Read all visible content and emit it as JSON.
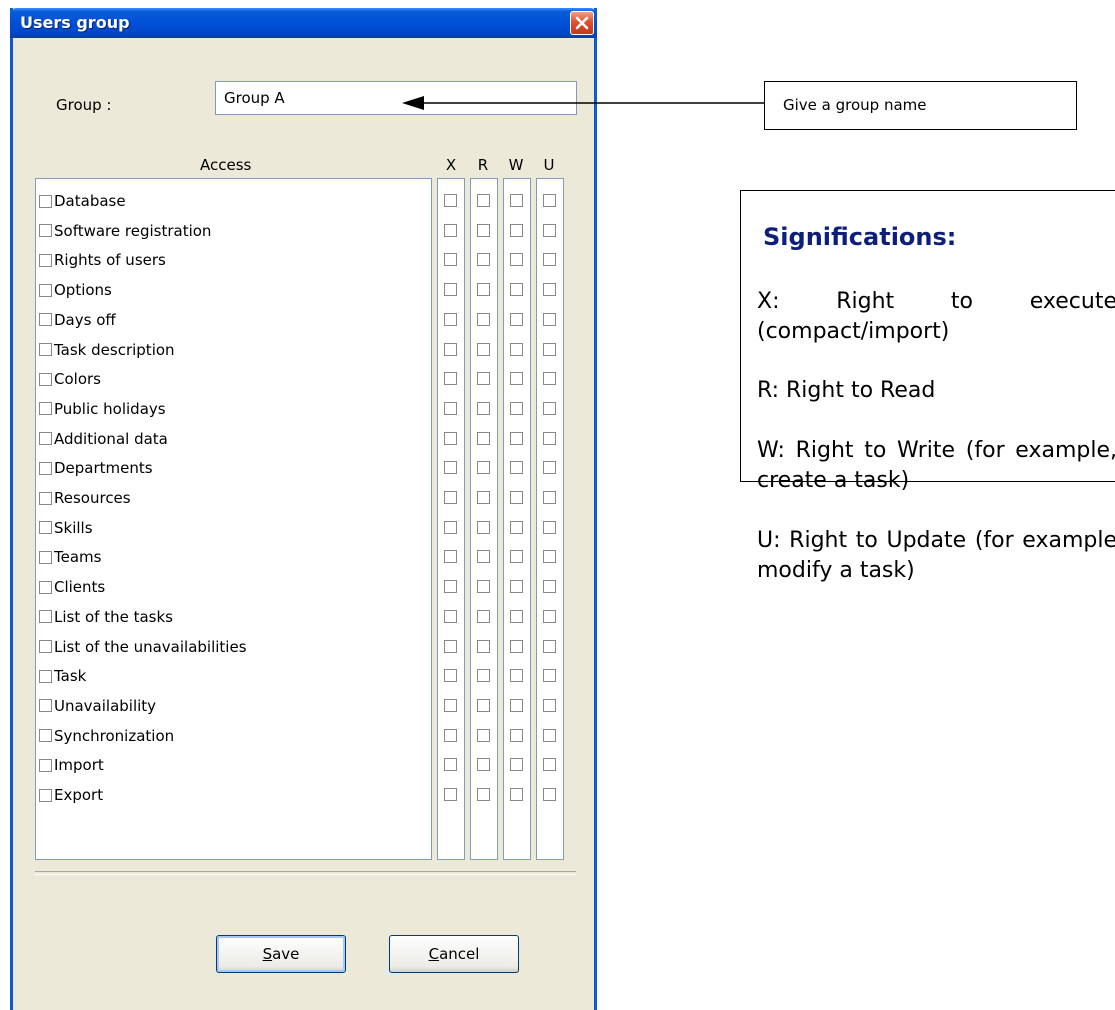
{
  "dialog": {
    "title": "Users group",
    "group_label": "Group :",
    "group_value": "Group A",
    "access_header": "Access",
    "perm_headers": [
      "X",
      "R",
      "W",
      "U"
    ],
    "access_items": [
      {
        "label": "Database"
      },
      {
        "label": "Software registration"
      },
      {
        "label": "Rights of users"
      },
      {
        "label": "Options"
      },
      {
        "label": "Days off"
      },
      {
        "label": "Task description"
      },
      {
        "label": "Colors"
      },
      {
        "label": "Public holidays"
      },
      {
        "label": "Additional data"
      },
      {
        "label": "Departments"
      },
      {
        "label": "Resources"
      },
      {
        "label": "Skills"
      },
      {
        "label": "Teams"
      },
      {
        "label": "Clients"
      },
      {
        "label": "List of the tasks"
      },
      {
        "label": "List of the unavailabilities"
      },
      {
        "label": "Task"
      },
      {
        "label": "Unavailability"
      },
      {
        "label": "Synchronization"
      },
      {
        "label": "Import"
      },
      {
        "label": "Export"
      }
    ],
    "save_label_mnemonic": "S",
    "save_label_rest": "ave",
    "cancel_label_mnemonic": "C",
    "cancel_label_rest": "ancel"
  },
  "annotation": {
    "callout_text": "Give a group name",
    "legend_title": "Significations:",
    "legend_items": [
      "X: Right to execute (compact/import)",
      "R: Right to Read",
      "W: Right to Write (for example, create a task)",
      "U: Right to Update (for example modify a task)"
    ]
  },
  "colors": {
    "titlebar": "#0050d8",
    "window_bg": "#ece9d8",
    "legend_title": "#0c1f7a",
    "close_button": "#e0502c"
  }
}
